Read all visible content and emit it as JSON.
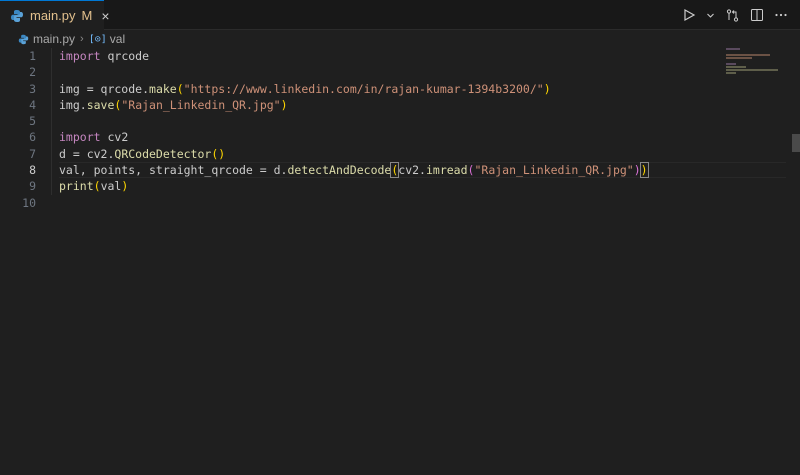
{
  "tab": {
    "filename": "main.py",
    "modified": "M",
    "close": "×"
  },
  "breadcrumb": {
    "file": "main.py",
    "separator": "›",
    "symbol_icon": "[⊙]",
    "symbol": "val"
  },
  "line_numbers": [
    "1",
    "2",
    "3",
    "4",
    "5",
    "6",
    "7",
    "8",
    "9",
    "10"
  ],
  "code": {
    "l1": {
      "kw": "import",
      "rest": " qrcode"
    },
    "l3": {
      "a": "img = qrcode.",
      "fn": "make",
      "p1": "(",
      "str": "\"https://www.linkedin.com/in/rajan-kumar-1394b3200/\"",
      "p2": ")"
    },
    "l4": {
      "a": "img.",
      "fn": "save",
      "p1": "(",
      "str": "\"Rajan_Linkedin_QR.jpg\"",
      "p2": ")"
    },
    "l6": {
      "kw": "import",
      "rest": " cv2"
    },
    "l7": {
      "a": "d = cv2.",
      "fn": "QRCodeDetector",
      "p": "()"
    },
    "l8": {
      "a": "val, points, straight_qrcode = d.",
      "fn": "detectAndDecode",
      "p1": "(",
      "b": "cv2.",
      "fn2": "imread",
      "p2": "(",
      "str": "\"Rajan_Linkedin_QR.jpg\"",
      "p3": ")",
      "p4": ")"
    },
    "l9": {
      "fn": "print",
      "p1": "(",
      "a": "val",
      "p2": ")"
    }
  },
  "colors": {
    "accent": "#0078d4",
    "keyword": "#c586c0",
    "function": "#dcdcaa",
    "string": "#ce9178",
    "bracket": "#ffd700"
  },
  "icons": [
    "python-file-icon",
    "run-icon",
    "chevron-down-icon",
    "source-control-compare-icon",
    "split-editor-icon",
    "more-icon",
    "variable-icon"
  ]
}
